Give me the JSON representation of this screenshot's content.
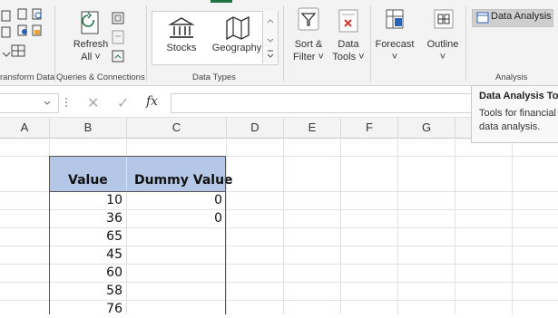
{
  "ribbon": {
    "groups": {
      "transform_data": "ransform Data",
      "queries_connections": "Queries & Connections",
      "data_types": "Data Types",
      "analysis": "Analysis"
    },
    "refresh_all": {
      "line1": "Refresh",
      "line2": "All ˅"
    },
    "data_types": {
      "stocks": "Stocks",
      "geography": "Geography"
    },
    "sort_filter": {
      "line1": "Sort &",
      "line2": "Filter ˅"
    },
    "data_tools": {
      "line1": "Data",
      "line2": "Tools ˅"
    },
    "forecast": {
      "line1": "Forecast",
      "line2": "˅"
    },
    "outline": {
      "line1": "Outline",
      "line2": "˅"
    },
    "data_analysis": "Data Analysis"
  },
  "formula_bar": {
    "fx": "fx",
    "cancel": "✕",
    "enter": "✓",
    "value": ""
  },
  "columns": [
    "A",
    "B",
    "C",
    "D",
    "E",
    "F",
    "G"
  ],
  "table": {
    "headers": [
      "Value",
      "Dummy Value"
    ],
    "rows": [
      [
        "10",
        "0"
      ],
      [
        "36",
        "0"
      ],
      [
        "65",
        ""
      ],
      [
        "45",
        ""
      ],
      [
        "60",
        ""
      ],
      [
        "58",
        ""
      ],
      [
        "76",
        ""
      ]
    ]
  },
  "tooltip": {
    "title": "Data Analysis Too",
    "line1": "Tools for financial a",
    "line2": "data analysis."
  },
  "colors": {
    "accent": "#217346",
    "table_header": "#b4c7e7",
    "ribbon_bg": "#f3f3f3"
  }
}
